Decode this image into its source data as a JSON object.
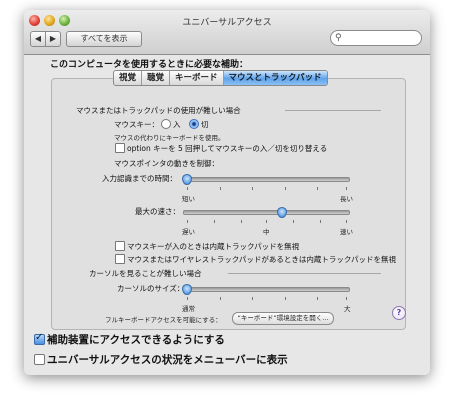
{
  "window": {
    "title": "ユニバーサルアクセス"
  },
  "toolbar": {
    "back_label": "◀",
    "forward_label": "▶",
    "show_all_label": "すべてを表示",
    "search_placeholder": ""
  },
  "heading": "このコンピュータを使用するときに必要な補助：",
  "tabs": [
    {
      "label": "視覚",
      "active": false
    },
    {
      "label": "聴覚",
      "active": false
    },
    {
      "label": "キーボード",
      "active": false
    },
    {
      "label": "マウスとトラックパッド",
      "active": true
    }
  ],
  "mouse_section": {
    "header": "マウスまたはトラックパッドの使用が難しい場合",
    "mouse_keys_label": "マウスキー：",
    "on_label": "入",
    "off_label": "切",
    "selected": "切",
    "note": "マウスの代わりにキーボードを使用。",
    "option_toggle": {
      "label": "option キーを 5 回押してマウスキーの入／切を切り替える",
      "checked": false
    },
    "pointer_control_label": "マウスポインタの動きを制御：",
    "initial_delay": {
      "label": "入力認識までの時間：",
      "min_label": "短い",
      "max_label": "長い",
      "value": 0.0
    },
    "max_speed": {
      "label": "最大の速さ：",
      "min_label": "遅い",
      "mid_label": "中",
      "max_label": "速い",
      "value": 0.57
    },
    "ignore_builtin_when_mousekeys": {
      "label": "マウスキーが入のときは内蔵トラックパッドを無視",
      "checked": false
    },
    "ignore_builtin_when_wireless": {
      "label": "マウスまたはワイヤレストラックパッドがあるときは内蔵トラックパッドを無視",
      "checked": false
    }
  },
  "cursor_section": {
    "header": "カーソルを見ることが難しい場合",
    "size": {
      "label": "カーソルのサイズ：",
      "min_label": "通常",
      "max_label": "大",
      "value": 0.0
    }
  },
  "full_keyboard": {
    "label": "フルキーボードアクセスを可能にする：",
    "button_label": "“キーボード”環境設定を開く..."
  },
  "help_label": "?",
  "bottom": {
    "assistive_devices": {
      "label": "補助装置にアクセスできるようにする",
      "checked": true
    },
    "menu_bar_status": {
      "label": "ユニバーサルアクセスの状況をメニューバーに表示",
      "checked": false
    }
  }
}
